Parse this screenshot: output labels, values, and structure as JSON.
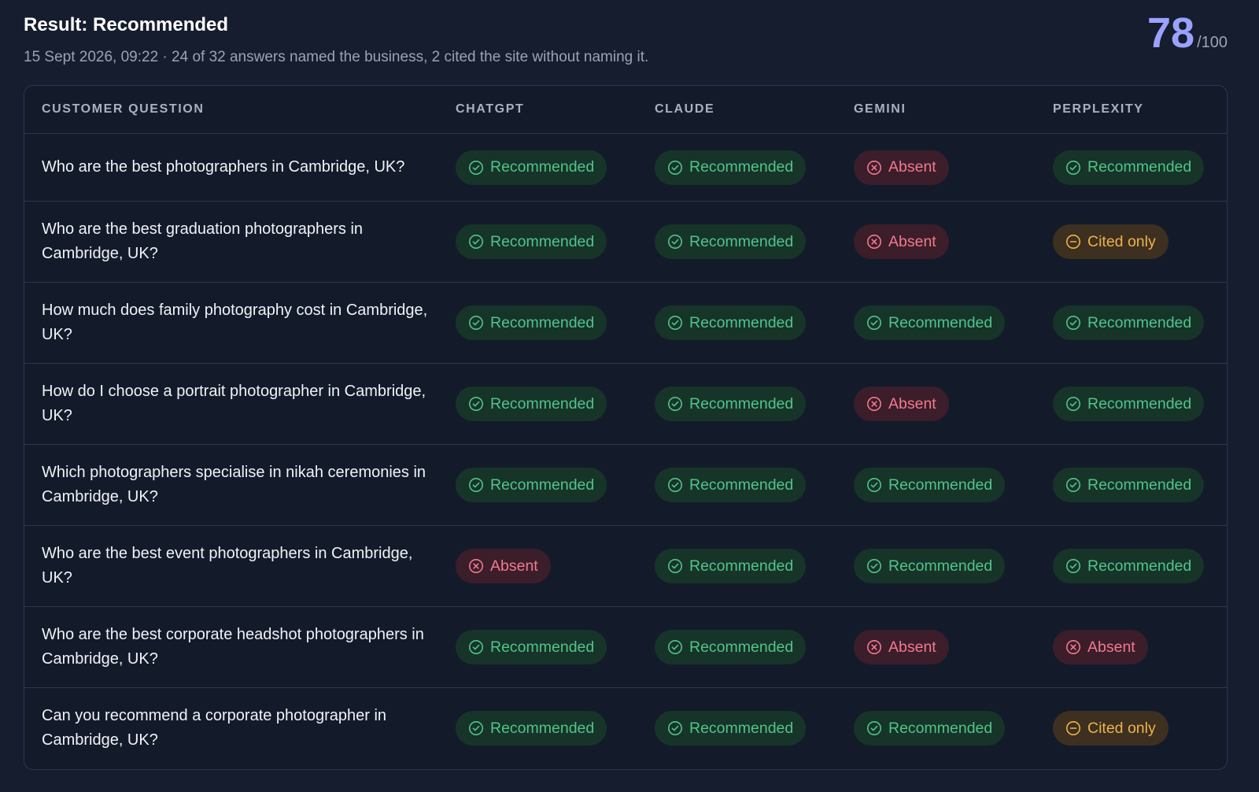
{
  "header": {
    "title": "Result: Recommended",
    "subtitle": "15 Sept 2026, 09:22 · 24 of 32 answers named the business, 2 cited the site without naming it.",
    "score": "78",
    "score_max": "/100"
  },
  "colors": {
    "recommended": "#4fc48c",
    "absent": "#f07a8f",
    "cited": "#eeb24a",
    "score": "#9aa2ff"
  },
  "table": {
    "columns": [
      "CUSTOMER QUESTION",
      "CHATGPT",
      "CLAUDE",
      "GEMINI",
      "PERPLEXITY"
    ],
    "status_labels": {
      "recommended": "Recommended",
      "absent": "Absent",
      "cited": "Cited only"
    },
    "status_icons": {
      "recommended": "check-circle-icon",
      "absent": "x-circle-icon",
      "cited": "minus-circle-icon"
    },
    "rows": [
      {
        "question": "Who are the best photographers in Cambridge, UK?",
        "results": [
          "recommended",
          "recommended",
          "absent",
          "recommended"
        ]
      },
      {
        "question": "Who are the best graduation photographers in Cambridge, UK?",
        "results": [
          "recommended",
          "recommended",
          "absent",
          "cited"
        ]
      },
      {
        "question": "How much does family photography cost in Cambridge, UK?",
        "results": [
          "recommended",
          "recommended",
          "recommended",
          "recommended"
        ]
      },
      {
        "question": "How do I choose a portrait photographer in Cambridge, UK?",
        "results": [
          "recommended",
          "recommended",
          "absent",
          "recommended"
        ]
      },
      {
        "question": "Which photographers specialise in nikah ceremonies in Cambridge, UK?",
        "results": [
          "recommended",
          "recommended",
          "recommended",
          "recommended"
        ]
      },
      {
        "question": "Who are the best event photographers in Cambridge, UK?",
        "results": [
          "absent",
          "recommended",
          "recommended",
          "recommended"
        ]
      },
      {
        "question": "Who are the best corporate headshot photographers in Cambridge, UK?",
        "results": [
          "recommended",
          "recommended",
          "absent",
          "absent"
        ]
      },
      {
        "question": "Can you recommend a corporate photographer in Cambridge, UK?",
        "results": [
          "recommended",
          "recommended",
          "recommended",
          "cited"
        ]
      }
    ]
  }
}
